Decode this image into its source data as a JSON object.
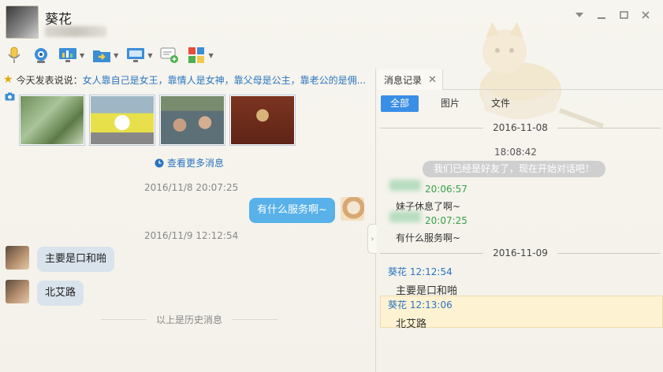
{
  "contact": {
    "name": "葵花"
  },
  "window_controls": [
    "dropdown-icon",
    "minimize-icon",
    "maximize-icon",
    "close-icon"
  ],
  "toolbar": {
    "items": [
      {
        "name": "voice-call-icon",
        "has_arrow": false
      },
      {
        "name": "video-call-icon",
        "has_arrow": false
      },
      {
        "name": "remote-assist-icon",
        "has_arrow": true
      },
      {
        "name": "file-transfer-icon",
        "has_arrow": true
      },
      {
        "name": "screen-share-icon",
        "has_arrow": true
      },
      {
        "name": "create-group-icon",
        "has_arrow": false
      },
      {
        "name": "apps-icon",
        "has_arrow": true
      }
    ]
  },
  "status": {
    "prefix": "今天发表说说：",
    "text": "女人靠自己是女王，靠情人是女神，靠父母是公主，靠老公的是佣..."
  },
  "photos_count": 4,
  "more_messages": "查看更多消息",
  "chat": {
    "timestamp1": "2016/11/8 20:07:25",
    "msg_self": "有什么服务啊~",
    "timestamp2": "2016/11/9 12:12:54",
    "msg1": "主要是口和啪",
    "msg2": "北艾路",
    "history_end": "以上是历史消息"
  },
  "history_panel": {
    "tab_label": "消息记录",
    "filters": [
      "全部",
      "图片",
      "文件"
    ],
    "active_filter": "全部",
    "date1": "2016-11-08",
    "time_sys": "18:08:42",
    "sys_msg": "我们已经是好友了，现在开始对话吧！",
    "entry1_time": "20:06:57",
    "entry1_text": "妹子休息了啊~",
    "entry2_time": "20:07:25",
    "entry2_text": "有什么服务啊~",
    "date2": "2016-11-09",
    "entry3_sender": "葵花",
    "entry3_time": "12:12:54",
    "entry3_text": "主要是口和啪",
    "entry4_sender": "葵花",
    "entry4_time": "12:13:06",
    "entry4_text": "北艾路"
  },
  "colors": {
    "accent_blue": "#3a8ee6",
    "bubble_self": "#58b1e8",
    "bubble_other": "#d9e3ec",
    "link": "#2a74c0",
    "green": "#3aa14b"
  }
}
